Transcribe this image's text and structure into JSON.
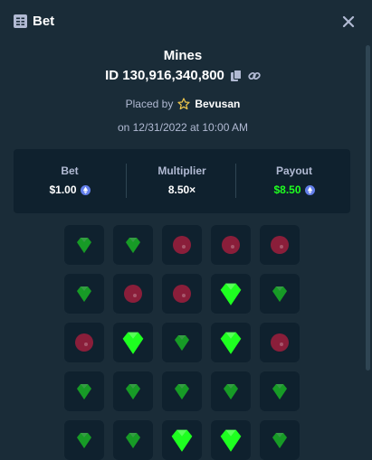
{
  "header": {
    "title": "Bet"
  },
  "game": {
    "name": "Mines",
    "bet_id": "ID 130,916,340,800",
    "placed_by_prefix": "Placed by",
    "username": "Bevusan",
    "date": "on 12/31/2022 at 10:00 AM"
  },
  "stats": {
    "bet_label": "Bet",
    "bet_value": "$1.00",
    "multiplier_label": "Multiplier",
    "multiplier_value": "8.50×",
    "payout_label": "Payout",
    "payout_value": "$8.50"
  },
  "colors": {
    "background": "#1a2c38",
    "panel": "#0f212e",
    "muted_text": "#b1bad3",
    "payout_green": "#1fff20",
    "gem_green": "#1fff20",
    "mine_red": "#a01d3c",
    "coin_blue": "#627eea"
  },
  "grid": {
    "columns": 5,
    "tiles": [
      [
        "gem",
        "gem",
        "mine",
        "mine",
        "mine"
      ],
      [
        "gem",
        "mine",
        "mine",
        "gem-revealed",
        "gem"
      ],
      [
        "mine",
        "gem-revealed",
        "gem",
        "gem-revealed",
        "mine"
      ],
      [
        "gem",
        "gem",
        "gem",
        "gem",
        "gem"
      ],
      [
        "gem",
        "gem",
        "gem-revealed",
        "gem-revealed",
        "gem"
      ]
    ]
  }
}
